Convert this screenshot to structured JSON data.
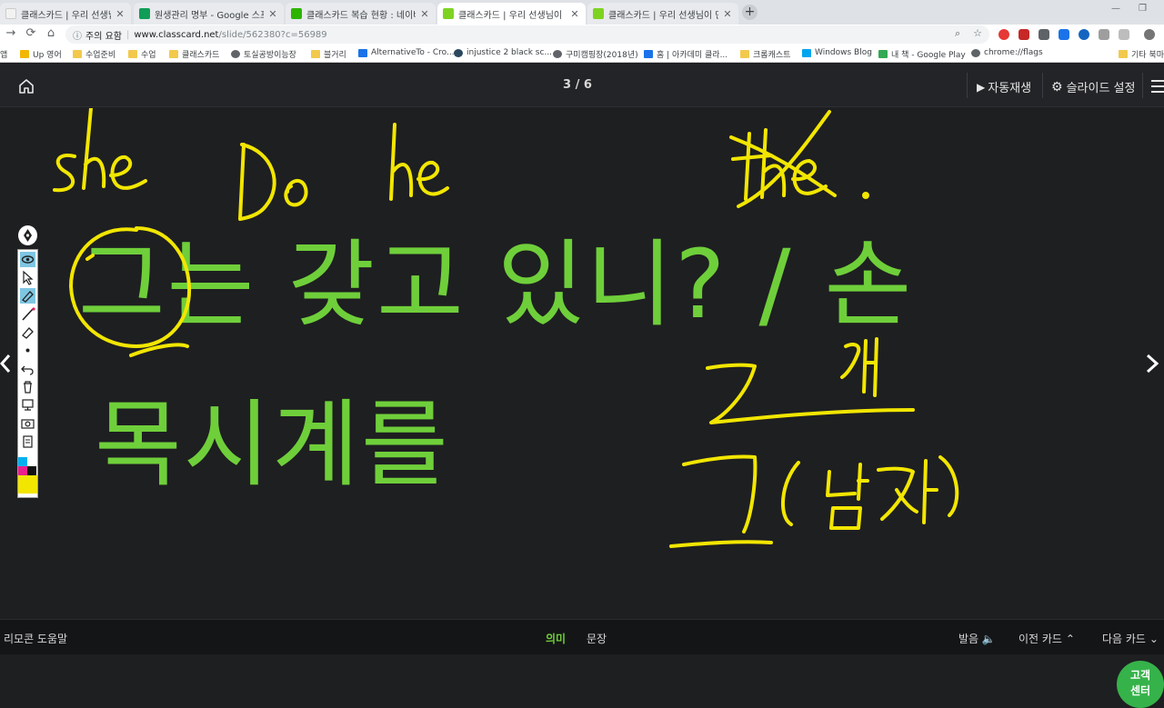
{
  "browser": {
    "tabs": [
      {
        "title": "클래스카드 | 우리 선생님이 만든",
        "favicon_color": "#f2f2f2",
        "active": false
      },
      {
        "title": "원생관리 명부 - Google 스프레드시트",
        "favicon_color": "#0f9d58",
        "active": false
      },
      {
        "title": "클래스카드 복습 현황 : 네이버 블로그",
        "favicon_color": "#2db400",
        "active": false
      },
      {
        "title": "클래스카드 | 우리 선생님이 만든",
        "favicon_color": "#7ed321",
        "active": true
      },
      {
        "title": "클래스카드 | 우리 선생님이 만든",
        "favicon_color": "#7ed321",
        "active": false
      }
    ],
    "new_tab": "+",
    "address": {
      "security_label": "주의 요함",
      "url_domain": "www.classcard.net",
      "url_path": "/slide/562380?c=56989"
    },
    "bookmarks": [
      {
        "label": "앱",
        "color": "#4285f4"
      },
      {
        "label": "Up 영어",
        "color": "#f2b705"
      },
      {
        "label": "수업준비",
        "color": "#f2c94c"
      },
      {
        "label": "수업",
        "color": "#f2c94c"
      },
      {
        "label": "클래스카드",
        "color": "#f2c94c"
      },
      {
        "label": "토실공방이능장",
        "color": "#5f6368"
      },
      {
        "label": "블거리",
        "color": "#f2c94c"
      },
      {
        "label": "AlternativeTo - Cro...",
        "color": "#1a73e8"
      },
      {
        "label": "injustice 2 black sc...",
        "color": "#2a475e"
      },
      {
        "label": "구미캠핑장(2018년)",
        "color": "#5f6368"
      },
      {
        "label": "홈 | 아카데미 클라...",
        "color": "#1a73e8"
      },
      {
        "label": "크롬캐스트",
        "color": "#f2c94c"
      },
      {
        "label": "Windows Blog",
        "color": "#00a4ef"
      },
      {
        "label": "내 책 - Google Play",
        "color": "#34a853"
      },
      {
        "label": "chrome://flags",
        "color": "#5f6368"
      },
      {
        "label": "기타 북마크",
        "color": "#f2c94c"
      }
    ]
  },
  "app": {
    "page_indicator": "3 / 6",
    "autoplay_label": "자동재생",
    "slide_settings_label": "슬라이드 설정",
    "icons": {
      "home": "home-icon",
      "play": "play-icon",
      "gear": "gear-icon",
      "menu": "menu-icon"
    }
  },
  "slide": {
    "line1": "그는 갖고 있니? / 손",
    "line2": "목시계를",
    "annotations": [
      "she",
      "Do",
      "he",
      "the",
      "그",
      "그",
      "(남자)"
    ],
    "help_line1": "고객",
    "help_line2": "센터"
  },
  "bottom": {
    "remote_help": "리모콘 도움말",
    "meaning_tab": "의미",
    "sentence_tab": "문장",
    "pronounce": "발음",
    "prev_card": "이전 카드",
    "next_card": "다음 카드"
  },
  "colors": {
    "slide_text": "#6fcf3a",
    "ink": "#f2e600",
    "accent": "#36b24a",
    "background": "#1e1f21"
  }
}
